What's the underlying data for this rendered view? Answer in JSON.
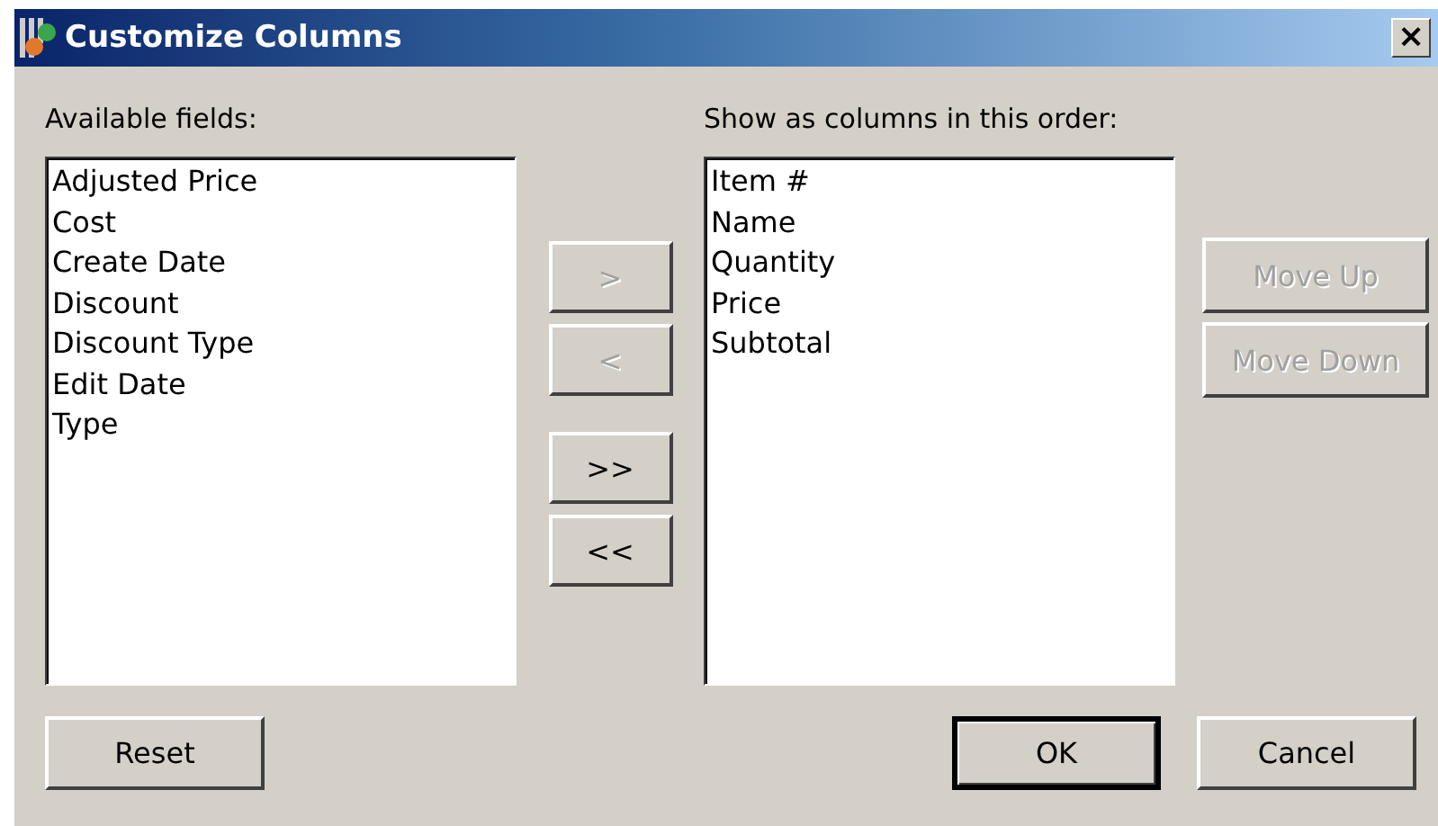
{
  "window": {
    "title": "Customize Columns",
    "close": "×"
  },
  "available": {
    "label": "Available fields:",
    "items": [
      {
        "text": "Adjusted Price",
        "selected": false
      },
      {
        "text": "Cost",
        "selected": false
      },
      {
        "text": "Create Date",
        "selected": false
      },
      {
        "text": "Discount",
        "selected": false
      },
      {
        "text": "Discount Type",
        "selected": false
      },
      {
        "text": "Edit Date",
        "selected": false
      },
      {
        "text": "Type",
        "selected": false
      }
    ]
  },
  "transfer_buttons": [
    {
      "label": ">",
      "disabled": true
    },
    {
      "label": "<",
      "disabled": true
    },
    {
      "label": ">>",
      "disabled": false
    },
    {
      "label": "<<",
      "disabled": false
    }
  ],
  "shown": {
    "label": "Show as columns in this order:",
    "items": [
      {
        "text": "Item #",
        "selected": false
      },
      {
        "text": "Name",
        "selected": false
      },
      {
        "text": "Quantity",
        "selected": false
      },
      {
        "text": "Price",
        "selected": false
      },
      {
        "text": "Subtotal",
        "selected": false
      }
    ]
  },
  "order_buttons": [
    {
      "label": "Move Up",
      "disabled": true
    },
    {
      "label": "Move Down",
      "disabled": true
    }
  ],
  "footer_buttons": [
    {
      "label": "Reset",
      "default": false
    },
    {
      "label": "OK",
      "default": true
    },
    {
      "label": "Cancel",
      "default": false
    }
  ]
}
